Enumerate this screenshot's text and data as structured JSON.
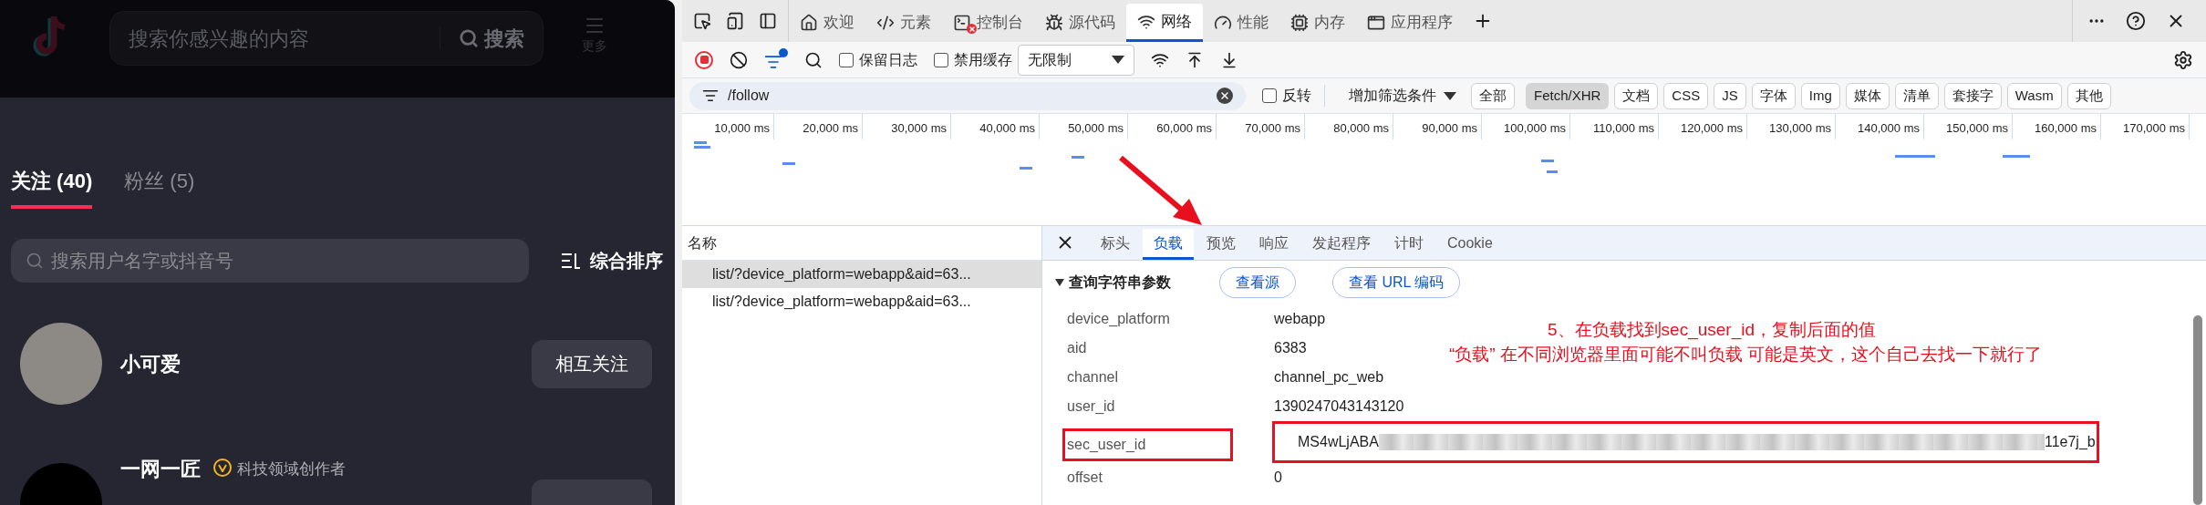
{
  "douyin": {
    "header": {
      "search_placeholder": "搜索你感兴趣的内容",
      "search_button": "搜索",
      "more": "更多"
    },
    "tabs": [
      {
        "label": "关注 (40)",
        "selected": true
      },
      {
        "label": "粉丝 (5)",
        "selected": false
      }
    ],
    "user_search": {
      "placeholder": "搜索用户名字或抖音号"
    },
    "sort": "综合排序",
    "users": [
      {
        "name": "小可爱",
        "button": "相互关注"
      },
      {
        "name": "一网一匠",
        "badge": "科技领域创作者"
      }
    ]
  },
  "devtools": {
    "tabs": [
      {
        "label": "欢迎",
        "selected": false
      },
      {
        "label": "元素",
        "selected": false
      },
      {
        "label": "控制台",
        "selected": false
      },
      {
        "label": "源代码",
        "selected": false
      },
      {
        "label": "网络",
        "selected": true
      },
      {
        "label": "性能",
        "selected": false
      },
      {
        "label": "内存",
        "selected": false
      },
      {
        "label": "应用程序",
        "selected": false
      }
    ],
    "toolbar": {
      "checkboxes": [
        {
          "label": "保留日志",
          "checked": false
        },
        {
          "label": "禁用缓存",
          "checked": false
        }
      ],
      "throttle": "无限制"
    },
    "filter": {
      "value": "/follow",
      "invert": {
        "label": "反转",
        "checked": false
      },
      "more_filters": "增加筛选条件",
      "types": [
        {
          "label": "全部",
          "selected": false
        },
        {
          "label": "Fetch/XHR",
          "selected": true
        },
        {
          "label": "文档",
          "selected": false
        },
        {
          "label": "CSS",
          "selected": false
        },
        {
          "label": "JS",
          "selected": false
        },
        {
          "label": "字体",
          "selected": false
        },
        {
          "label": "Img",
          "selected": false
        },
        {
          "label": "媒体",
          "selected": false
        },
        {
          "label": "清单",
          "selected": false
        },
        {
          "label": "套接字",
          "selected": false
        },
        {
          "label": "Wasm",
          "selected": false
        },
        {
          "label": "其他",
          "selected": false
        }
      ]
    },
    "timeline_ticks": [
      "10,000 ms",
      "20,000 ms",
      "30,000 ms",
      "40,000 ms",
      "50,000 ms",
      "60,000 ms",
      "70,000 ms",
      "80,000 ms",
      "90,000 ms",
      "100,000 ms",
      "110,000 ms",
      "120,000 ms",
      "130,000 ms",
      "140,000 ms",
      "150,000 ms",
      "160,000 ms",
      "170,000 ms"
    ],
    "requests": {
      "header": "名称",
      "rows": [
        {
          "name": "list/?device_platform=webapp&aid=63...",
          "selected": true
        },
        {
          "name": "list/?device_platform=webapp&aid=63...",
          "selected": false
        }
      ]
    },
    "detail_tabs": [
      {
        "label": "标头",
        "selected": false
      },
      {
        "label": "负载",
        "selected": true
      },
      {
        "label": "预览",
        "selected": false
      },
      {
        "label": "响应",
        "selected": false
      },
      {
        "label": "发起程序",
        "selected": false
      },
      {
        "label": "计时",
        "selected": false
      },
      {
        "label": "Cookie",
        "selected": false
      }
    ],
    "payload": {
      "section": "查询字符串参数",
      "buttons": [
        "查看源",
        "查看 URL 编码"
      ],
      "params": [
        {
          "name": "device_platform",
          "value": "webapp"
        },
        {
          "name": "aid",
          "value": "6383"
        },
        {
          "name": "channel",
          "value": "channel_pc_web"
        },
        {
          "name": "user_id",
          "value": "1390247043143120"
        },
        {
          "name": "sec_user_id",
          "value": "MS4wLjABA",
          "value_end": "11e7j_b",
          "redacted": true,
          "highlighted": true
        },
        {
          "name": "offset",
          "value": "0"
        }
      ]
    }
  },
  "annotation": [
    "5、在负载找到sec_user_id，复制后面的值",
    "“负载” 在不同浏览器里面可能不叫负载 可能是英文，这个自己去找一下就行了"
  ]
}
